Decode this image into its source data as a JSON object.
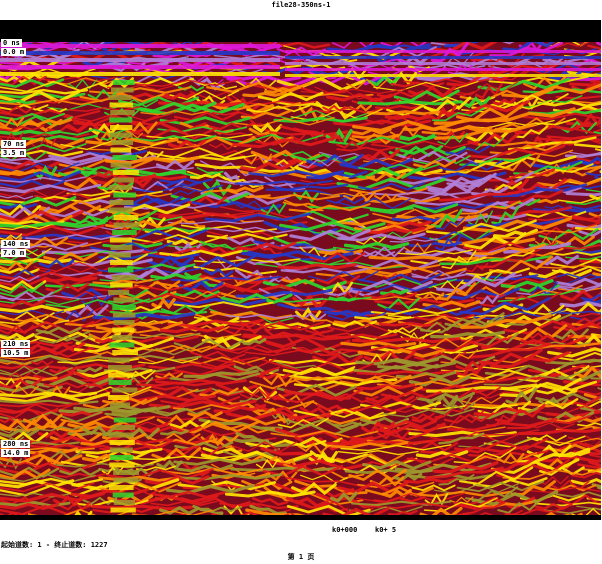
{
  "file_title": "file28-350ns-1",
  "depth_labels": [
    {
      "ns": "0   ns",
      "m": "0.0  m"
    },
    {
      "ns": "70   ns",
      "m": "3.5  m"
    },
    {
      "ns": "140  ns",
      "m": "7.0  m"
    },
    {
      "ns": "210  ns",
      "m": "10.5 m"
    },
    {
      "ns": "280  ns",
      "m": "14.0 m"
    }
  ],
  "distance_labels": [
    "k0+000",
    "k0+  5"
  ],
  "trace_info": "起始道数: 1 - 终止道数: 1227",
  "page_number": "第 1 页",
  "palette": {
    "background": "#7a0a1e",
    "red": "#e01a1a",
    "orange": "#ff8c00",
    "yellow": "#ffe600",
    "olive": "#9c9a2c",
    "green": "#2cd82c",
    "blue": "#2338c8",
    "magenta": "#e018d8",
    "violet": "#b080d8",
    "black": "#000000"
  }
}
